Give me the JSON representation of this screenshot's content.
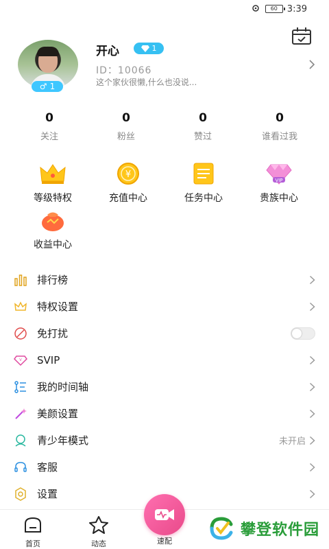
{
  "status_bar": {
    "battery": "60",
    "time": "3:39"
  },
  "profile": {
    "nickname": "开心",
    "vip_level": "1",
    "gender_level": "1",
    "id_text": "ID：10066",
    "signature": "这个家伙很懒,什么也没说..."
  },
  "stats": [
    {
      "value": "0",
      "label": "关注"
    },
    {
      "value": "0",
      "label": "粉丝"
    },
    {
      "value": "0",
      "label": "赞过"
    },
    {
      "value": "0",
      "label": "谁看过我"
    }
  ],
  "features": [
    {
      "label": "等级特权",
      "icon": "crown-icon"
    },
    {
      "label": "充值中心",
      "icon": "coin-icon"
    },
    {
      "label": "任务中心",
      "icon": "task-icon"
    },
    {
      "label": "贵族中心",
      "icon": "vip-gem-icon"
    },
    {
      "label": "收益中心",
      "icon": "money-bag-icon"
    }
  ],
  "menu": [
    {
      "label": "排行榜",
      "icon": "ranking-icon"
    },
    {
      "label": "特权设置",
      "icon": "privilege-icon"
    },
    {
      "label": "免打扰",
      "icon": "do-not-disturb-icon",
      "toggle": false
    },
    {
      "label": "SVIP",
      "icon": "svip-icon"
    },
    {
      "label": "我的时间轴",
      "icon": "timeline-icon"
    },
    {
      "label": "美颜设置",
      "icon": "beauty-wand-icon"
    },
    {
      "label": "青少年模式",
      "icon": "teen-mode-icon",
      "value": "未开启"
    },
    {
      "label": "客服",
      "icon": "headset-icon"
    },
    {
      "label": "设置",
      "icon": "gear-icon"
    }
  ],
  "bottom_nav": {
    "home": "首页",
    "moments": "动态",
    "match": "速配"
  },
  "watermark": "攀登软件园",
  "colors": {
    "accent_pink": "#e94a8a",
    "badge_blue": "#36c0f2",
    "watermark_green": "#2a9d3a"
  }
}
